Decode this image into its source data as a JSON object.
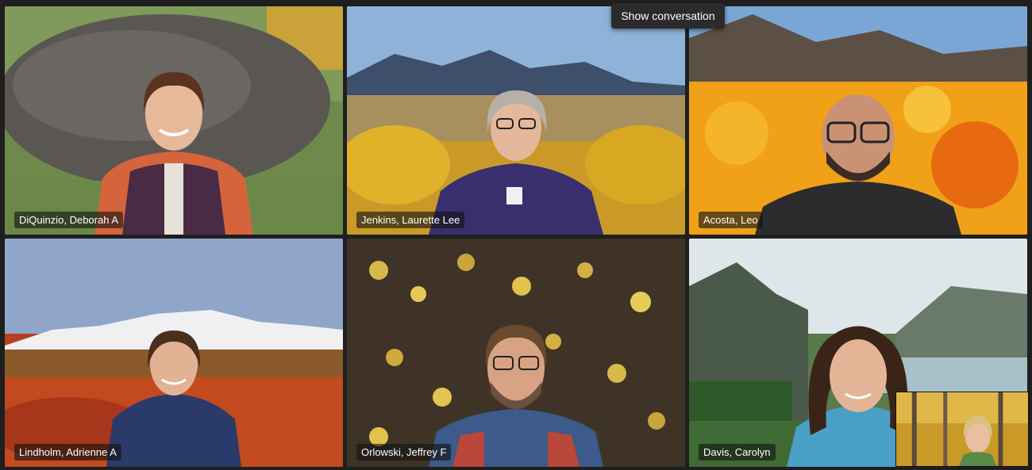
{
  "meeting": {
    "tooltip": "Show conversation",
    "participants": [
      {
        "name": "DiQuinzio, Deborah A",
        "background": "boulder"
      },
      {
        "name": "Jenkins, Laurette Lee",
        "background": "tetons-autumn",
        "active_speaker": true
      },
      {
        "name": "Acosta, Leo",
        "background": "poppy-field"
      },
      {
        "name": "Lindholm, Adrienne A",
        "background": "tundra-mountains"
      },
      {
        "name": "Orlowski, Jeffrey F",
        "background": "aspen-leaves"
      },
      {
        "name": "Davis, Carolyn",
        "background": "mountain-lake"
      }
    ],
    "self_view": {
      "background": "aspen-forest"
    }
  },
  "colors": {
    "active_speaker_border": "#8f92e8",
    "app_background": "#1f1f1f",
    "name_tag_background": "rgba(20,20,20,0.62)"
  }
}
